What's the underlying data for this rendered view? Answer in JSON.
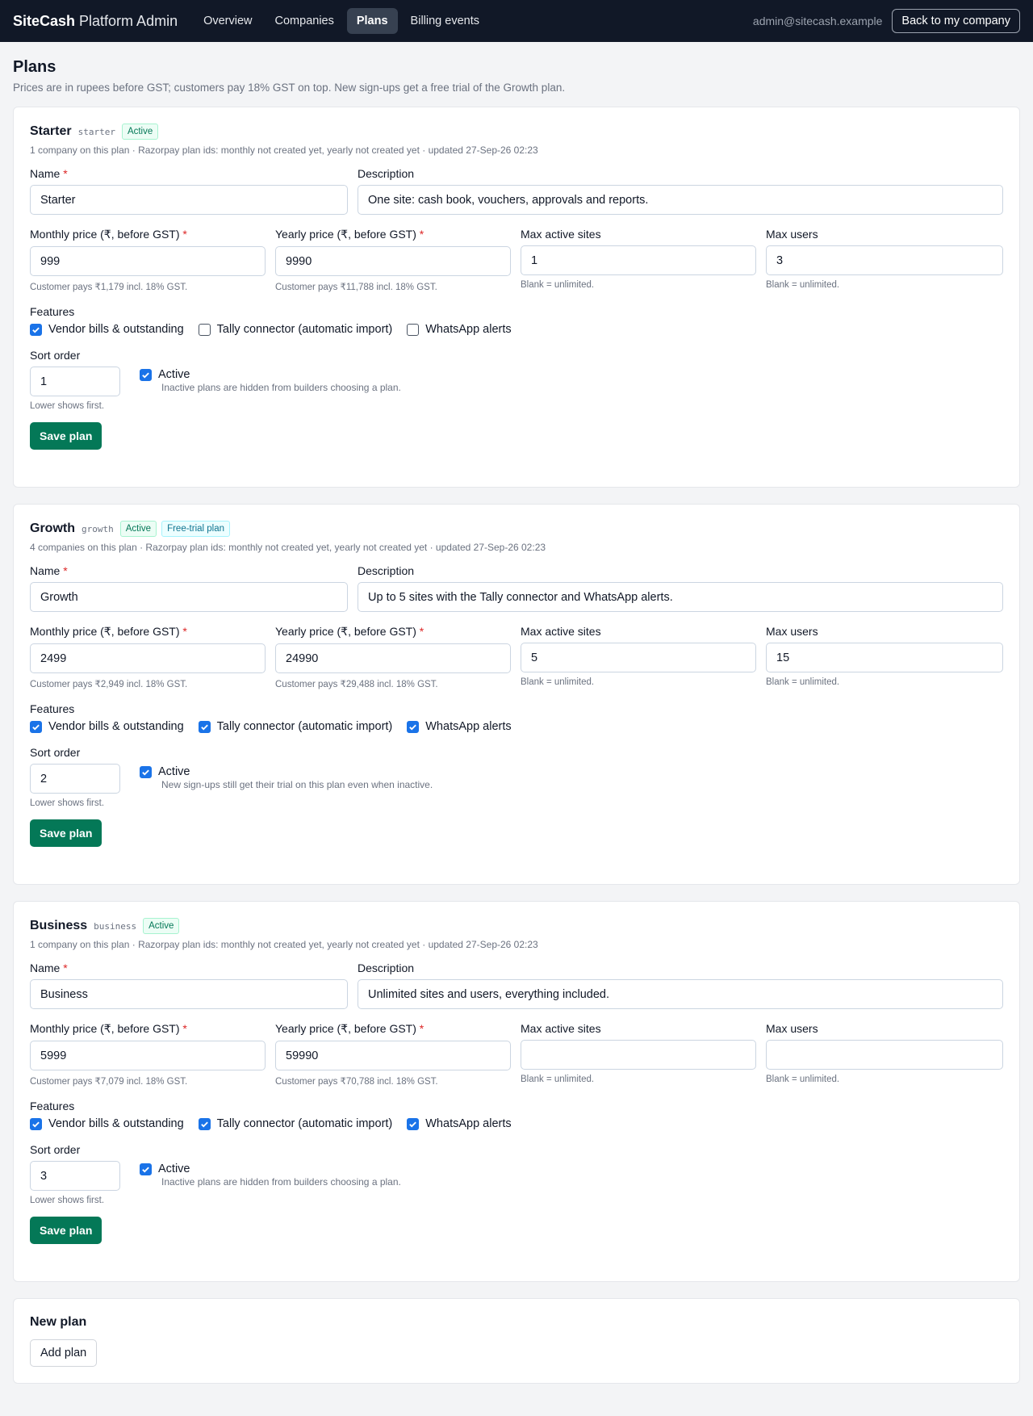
{
  "header": {
    "brand_bold": "SiteCash",
    "brand_rest": " Platform Admin",
    "nav": [
      {
        "label": "Overview",
        "active": false
      },
      {
        "label": "Companies",
        "active": false
      },
      {
        "label": "Plans",
        "active": true
      },
      {
        "label": "Billing events",
        "active": false
      }
    ],
    "admin_email": "admin@sitecash.example",
    "back_label": "Back to my company"
  },
  "page": {
    "title": "Plans",
    "subtitle": "Prices are in rupees before GST; customers pay 18% GST on top. New sign-ups get a free trial of the Growth plan."
  },
  "labels": {
    "name": "Name",
    "description": "Description",
    "monthly": "Monthly price (₹, before GST)",
    "yearly": "Yearly price (₹, before GST)",
    "max_sites": "Max active sites",
    "max_users": "Max users",
    "required_mark": "*",
    "features": "Features",
    "sort_order": "Sort order",
    "sort_hint": "Lower shows first.",
    "active": "Active",
    "save": "Save plan",
    "unlimited_hint": "Blank = unlimited.",
    "feature_vendor": "Vendor bills & outstanding",
    "feature_tally": "Tally connector (automatic import)",
    "feature_whatsapp": "WhatsApp alerts"
  },
  "plans": [
    {
      "name": "Starter",
      "code": "starter",
      "badges": [
        "Active"
      ],
      "meta": "1 company on this plan · Razorpay plan ids: monthly not created yet, yearly not created yet · updated 27-Sep-26 02:23",
      "name_value": "Starter",
      "description": "One site: cash book, vouchers, approvals and reports.",
      "monthly": "999",
      "monthly_hint": "Customer pays ₹1,179 incl. 18% GST.",
      "yearly": "9990",
      "yearly_hint": "Customer pays ₹11,788 incl. 18% GST.",
      "max_sites": "1",
      "max_users": "3",
      "features": {
        "vendor": true,
        "tally": false,
        "whatsapp": false
      },
      "sort_order": "1",
      "active": true,
      "active_hint": "Inactive plans are hidden from builders choosing a plan."
    },
    {
      "name": "Growth",
      "code": "growth",
      "badges": [
        "Active",
        "Free-trial plan"
      ],
      "meta": "4 companies on this plan · Razorpay plan ids: monthly not created yet, yearly not created yet · updated 27-Sep-26 02:23",
      "name_value": "Growth",
      "description": "Up to 5 sites with the Tally connector and WhatsApp alerts.",
      "monthly": "2499",
      "monthly_hint": "Customer pays ₹2,949 incl. 18% GST.",
      "yearly": "24990",
      "yearly_hint": "Customer pays ₹29,488 incl. 18% GST.",
      "max_sites": "5",
      "max_users": "15",
      "features": {
        "vendor": true,
        "tally": true,
        "whatsapp": true
      },
      "sort_order": "2",
      "active": true,
      "active_hint": "New sign-ups still get their trial on this plan even when inactive."
    },
    {
      "name": "Business",
      "code": "business",
      "badges": [
        "Active"
      ],
      "meta": "1 company on this plan · Razorpay plan ids: monthly not created yet, yearly not created yet · updated 27-Sep-26 02:23",
      "name_value": "Business",
      "description": "Unlimited sites and users, everything included.",
      "monthly": "5999",
      "monthly_hint": "Customer pays ₹7,079 incl. 18% GST.",
      "yearly": "59990",
      "yearly_hint": "Customer pays ₹70,788 incl. 18% GST.",
      "max_sites": "",
      "max_users": "",
      "features": {
        "vendor": true,
        "tally": true,
        "whatsapp": true
      },
      "sort_order": "3",
      "active": true,
      "active_hint": "Inactive plans are hidden from builders choosing a plan."
    }
  ],
  "new_plan": {
    "title": "New plan",
    "add_label": "Add plan"
  },
  "colors": {
    "topbar": "#111827",
    "primary_button": "#047857",
    "checkbox": "#1a73e8",
    "required": "#dc2626"
  }
}
